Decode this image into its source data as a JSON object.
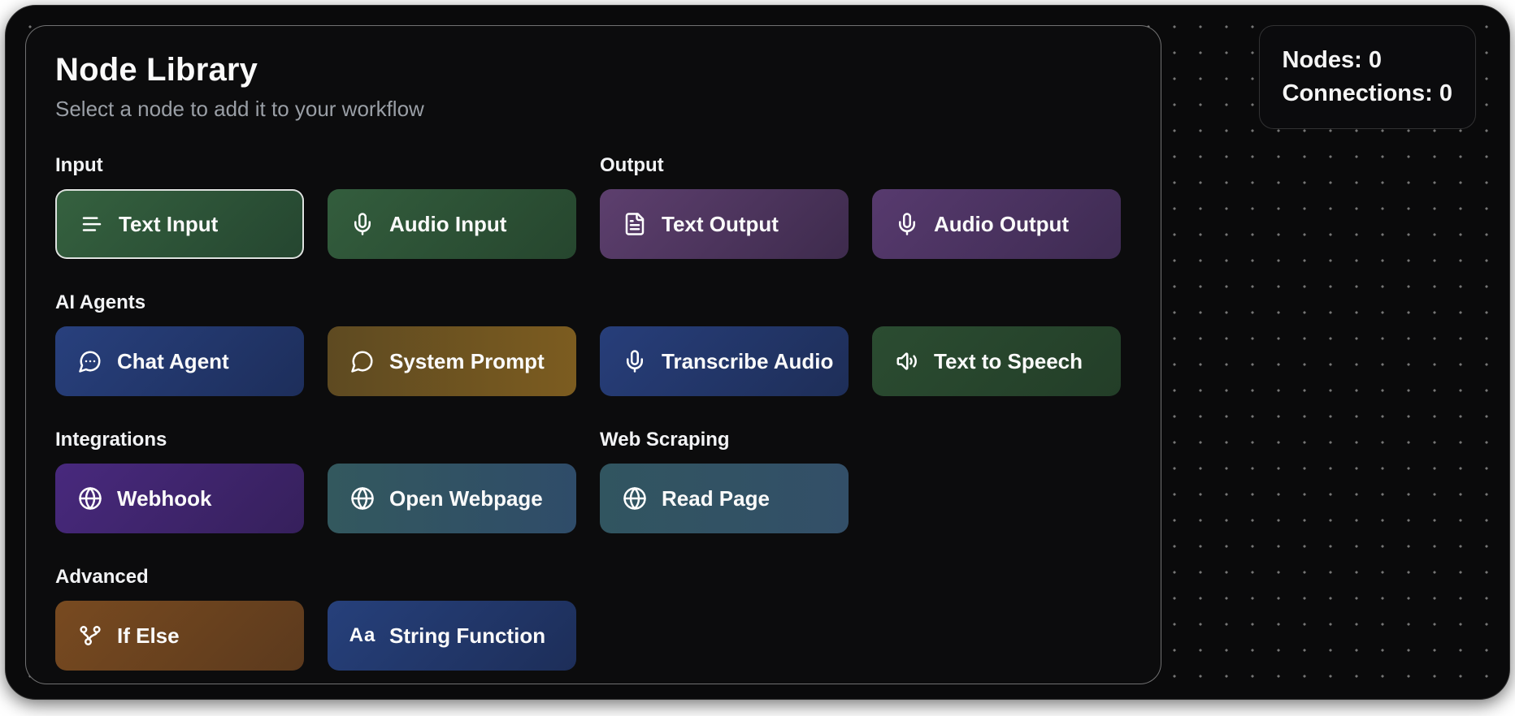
{
  "colors": {
    "page_bg": "#ffffff",
    "canvas_bg": "#0a0a0b",
    "canvas_dot": "#757575",
    "panel_bg": "#0c0c0d",
    "panel_border": "rgba(255,255,255,0.42)",
    "selected_node_border": "rgba(238,238,238,0.92)",
    "title_color": "#fafafa",
    "subtitle_color": "#9a9fa6"
  },
  "library": {
    "title": "Node Library",
    "subtitle": "Select a node to add it to your workflow",
    "sections": {
      "input": {
        "label": "Input"
      },
      "output": {
        "label": "Output"
      },
      "ai_agents": {
        "label": "AI Agents"
      },
      "integrations": {
        "label": "Integrations"
      },
      "web_scraping": {
        "label": "Web Scraping"
      },
      "advanced": {
        "label": "Advanced"
      }
    },
    "nodes": {
      "text_input": {
        "label": "Text Input",
        "icon": "text-lines-icon",
        "selected": true,
        "ga": "135deg",
        "g1": "#35613f",
        "g2": "#254630"
      },
      "audio_input": {
        "label": "Audio Input",
        "icon": "microphone-icon",
        "selected": false,
        "ga": "135deg",
        "g1": "#335d3d",
        "g2": "#26462e"
      },
      "text_output": {
        "label": "Text Output",
        "icon": "file-text-icon",
        "selected": false,
        "ga": "135deg",
        "g1": "#5d3f6e",
        "g2": "#3e2b4d"
      },
      "audio_output": {
        "label": "Audio Output",
        "icon": "microphone-icon",
        "selected": false,
        "ga": "135deg",
        "g1": "#573a6e",
        "g2": "#3e2b52"
      },
      "chat_agent": {
        "label": "Chat Agent",
        "icon": "chat-bubble-dots-icon",
        "selected": false,
        "ga": "135deg",
        "g1": "#28407d",
        "g2": "#1d2e5b"
      },
      "system_prompt": {
        "label": "System Prompt",
        "icon": "chat-bubble-icon",
        "selected": false,
        "ga": "90deg",
        "g1": "#5e4a21",
        "g2": "#7c5c20"
      },
      "transcribe_audio": {
        "label": "Transcribe Audio",
        "icon": "microphone-icon",
        "selected": false,
        "ga": "135deg",
        "g1": "#273e7a",
        "g2": "#1e2e58"
      },
      "text_to_speech": {
        "label": "Text to Speech",
        "icon": "speaker-icon",
        "selected": false,
        "ga": "135deg",
        "g1": "#2b4c31",
        "g2": "#233e28"
      },
      "webhook": {
        "label": "Webhook",
        "icon": "globe-icon",
        "selected": false,
        "ga": "135deg",
        "g1": "#48297d",
        "g2": "#36205c"
      },
      "open_webpage": {
        "label": "Open Webpage",
        "icon": "globe-icon",
        "selected": false,
        "ga": "90deg",
        "g1": "#33585e",
        "g2": "#2f4c69"
      },
      "read_page": {
        "label": "Read Page",
        "icon": "globe-icon",
        "selected": false,
        "ga": "90deg",
        "g1": "#315560",
        "g2": "#334f68"
      },
      "if_else": {
        "label": "If Else",
        "icon": "branch-icon",
        "selected": false,
        "ga": "135deg",
        "g1": "#784a20",
        "g2": "#5c3a1d"
      },
      "string_function": {
        "label": "String Function",
        "icon": "letters-aa-icon",
        "selected": false,
        "ga": "135deg",
        "g1": "#26407b",
        "g2": "#1d2e59"
      }
    },
    "aa_glyph": "Aa"
  },
  "stats": {
    "nodes_label": "Nodes:",
    "nodes_value": "0",
    "connections_label": "Connections:",
    "connections_value": "0"
  }
}
